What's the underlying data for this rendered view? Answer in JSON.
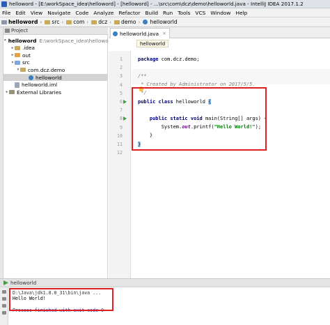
{
  "window": {
    "title": "helloword - [E:\\workSpace_idea\\helloword] - [helloword] - ...\\src\\com\\dcz\\demo\\helloworld.java - IntelliJ IDEA 2017.1.2"
  },
  "menu": [
    "File",
    "Edit",
    "View",
    "Navigate",
    "Code",
    "Analyze",
    "Refactor",
    "Build",
    "Run",
    "Tools",
    "VCS",
    "Window",
    "Help"
  ],
  "breadcrumb": [
    "helloword",
    "src",
    "com",
    "dcz",
    "demo",
    "helloworld"
  ],
  "project_panel": {
    "title": "Project",
    "tree": [
      {
        "label": "helloword",
        "extra": "E:\\workSpace_idea\\helloword",
        "icon": "folder-icon",
        "arrow": "▾",
        "bold": true
      },
      {
        "label": ".idea",
        "extra": "",
        "icon": "folder-icon",
        "arrow": "▸",
        "bold": false
      },
      {
        "label": "out",
        "extra": "",
        "icon": "folder-orange-icon",
        "arrow": "▸",
        "bold": false
      },
      {
        "label": "src",
        "extra": "",
        "icon": "source-folder-icon",
        "arrow": "▾",
        "bold": false
      },
      {
        "label": "com.dcz.demo",
        "extra": "",
        "icon": "package-icon",
        "arrow": "▾",
        "bold": false
      },
      {
        "label": "helloworld",
        "extra": "",
        "icon": "java-class-icon",
        "arrow": "",
        "bold": false,
        "selected": true
      },
      {
        "label": "helloworld.iml",
        "extra": "",
        "icon": "iml-file-icon",
        "arrow": "",
        "bold": false
      },
      {
        "label": "External Libraries",
        "extra": "",
        "icon": "library-icon",
        "arrow": "▸",
        "bold": false
      }
    ]
  },
  "editor": {
    "tab": "helloworld.java",
    "tab_close": "×",
    "hint": "helloworld",
    "lines": [
      {
        "n": "1",
        "tokens": [
          {
            "t": "package ",
            "c": "kw"
          },
          {
            "t": "com.dcz.demo;",
            "c": ""
          }
        ]
      },
      {
        "n": "2",
        "tokens": []
      },
      {
        "n": "3",
        "tokens": [
          {
            "t": "/**",
            "c": "cm"
          }
        ]
      },
      {
        "n": "4",
        "tokens": [
          {
            "t": " * Created by Administrator on 2017/5/5.",
            "c": "cm"
          }
        ]
      },
      {
        "n": "5",
        "tokens": [
          {
            "t": " */",
            "c": "cm"
          }
        ]
      },
      {
        "n": "6",
        "tokens": [
          {
            "t": "public class ",
            "c": "kw"
          },
          {
            "t": "helloworld ",
            "c": ""
          },
          {
            "t": "{",
            "c": "brace-hl"
          }
        ]
      },
      {
        "n": "7",
        "tokens": []
      },
      {
        "n": "8",
        "tokens": [
          {
            "t": "    public static void ",
            "c": "kw"
          },
          {
            "t": "main(String[] args) {",
            "c": ""
          }
        ]
      },
      {
        "n": "9",
        "tokens": [
          {
            "t": "        System.",
            "c": ""
          },
          {
            "t": "out",
            "c": "fld"
          },
          {
            "t": ".printf(",
            "c": ""
          },
          {
            "t": "\"Hello World!\"",
            "c": "st"
          },
          {
            "t": ");",
            "c": ""
          }
        ]
      },
      {
        "n": "10",
        "tokens": [
          {
            "t": "    }",
            "c": ""
          }
        ]
      },
      {
        "n": "11",
        "tokens": [
          {
            "t": "}",
            "c": "brace-hl"
          }
        ]
      },
      {
        "n": "12",
        "tokens": []
      }
    ],
    "run_lines": [
      "6",
      "8"
    ]
  },
  "run_panel": {
    "title": "helloworld",
    "output": [
      {
        "text": "D:\\Java\\jdk1.8.0_31\\bin\\java ...",
        "kind": "path"
      },
      {
        "text": "Hello World!",
        "kind": "hello"
      },
      {
        "text": "",
        "kind": "hello"
      },
      {
        "text": "Process finished with exit code 0",
        "kind": "done"
      }
    ]
  },
  "colors": {
    "highlight_box": "#e02020",
    "selection": "#d3d3d3",
    "keyword": "#000080",
    "string": "#008000"
  }
}
